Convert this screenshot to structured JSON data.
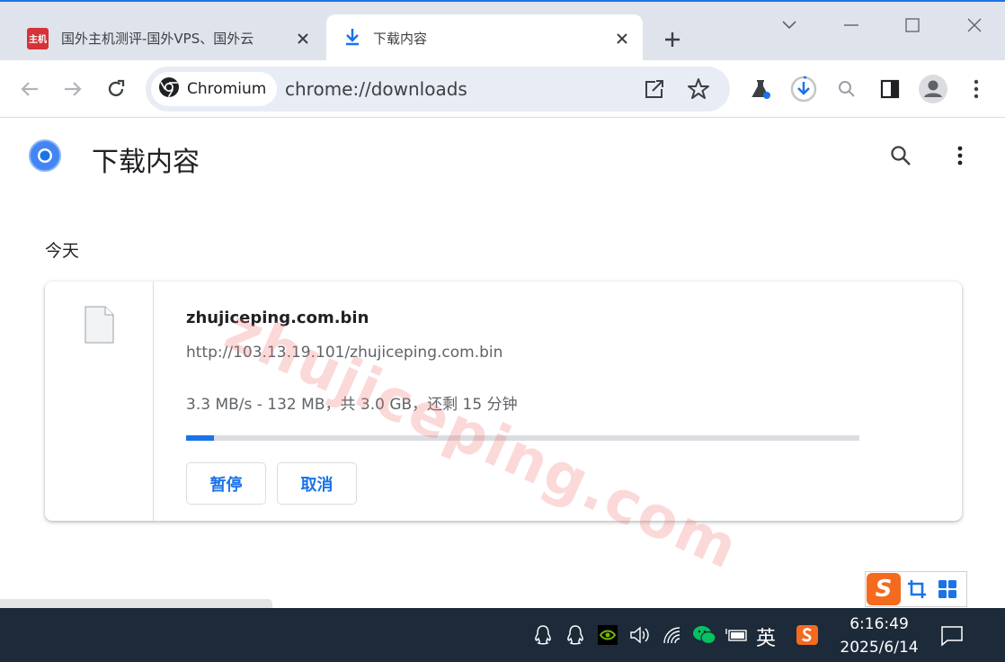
{
  "tabs": [
    {
      "title": "国外主机测评-国外VPS、国外云",
      "favicon_text": "主机",
      "active": false
    },
    {
      "title": "下载内容",
      "active": true
    }
  ],
  "omnibox": {
    "chip_label": "Chromium",
    "url": "chrome://downloads"
  },
  "page": {
    "title": "下载内容",
    "section_label": "今天"
  },
  "download": {
    "file_name": "zhujiceping.com.bin",
    "url": "http://103.13.19.101/zhujiceping.com.bin",
    "status": "3.3 MB/s - 132 MB，共 3.0 GB，还剩 15 分钟",
    "progress_fraction": 0.042,
    "pause_label": "暂停",
    "cancel_label": "取消"
  },
  "watermark": "zhujiceping.com",
  "ime": {
    "logo_text": "S"
  },
  "taskbar": {
    "language": "英",
    "time": "6:16:49",
    "date": "2025/6/14"
  },
  "colors": {
    "accent": "#1a73e8",
    "tabstrip": "#dfe3eb",
    "omnibox": "#e8ecf5",
    "taskbar": "#1c2a3a",
    "sogou_orange": "#f46a1e"
  }
}
